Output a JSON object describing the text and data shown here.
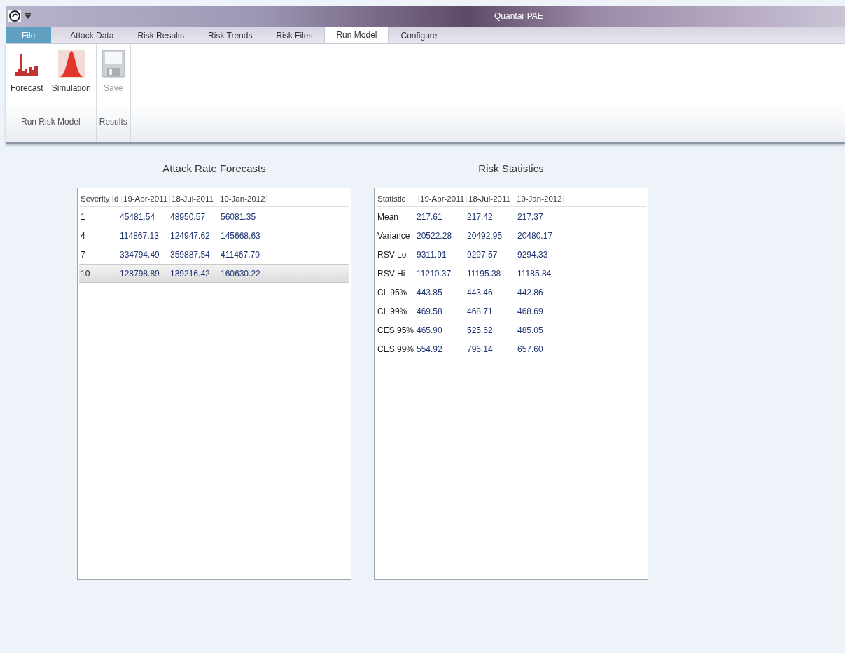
{
  "window": {
    "title": "Quantar PAE"
  },
  "tabs": [
    {
      "label": "File",
      "kind": "file",
      "selected": false
    },
    {
      "label": "Attack Data",
      "kind": "tab",
      "selected": false
    },
    {
      "label": "Risk Results",
      "kind": "tab",
      "selected": false
    },
    {
      "label": "Risk Trends",
      "kind": "tab",
      "selected": false
    },
    {
      "label": "Risk Files",
      "kind": "tab",
      "selected": false
    },
    {
      "label": "Run Model",
      "kind": "tab",
      "selected": true
    },
    {
      "label": "Configure",
      "kind": "tab",
      "selected": false
    }
  ],
  "ribbon_groups": [
    {
      "label": "Run Risk Model",
      "buttons": [
        {
          "label": "Forecast",
          "kind": "forecast",
          "disabled": false
        },
        {
          "label": "Simulation",
          "kind": "simulation",
          "disabled": false
        }
      ]
    },
    {
      "label": "Results",
      "buttons": [
        {
          "label": "Save",
          "kind": "save",
          "disabled": true
        }
      ]
    }
  ],
  "panels": [
    {
      "title": "Attack Rate Forecasts",
      "columns": [
        "Severity Id",
        "19-Apr-2011",
        "18-Jul-2011",
        "19-Jan-2012"
      ],
      "rows": [
        {
          "cells": [
            "1",
            "45481.54",
            "48950.57",
            "56081.35"
          ],
          "selected": false
        },
        {
          "cells": [
            "4",
            "114867.13",
            "124947.62",
            "145668.63"
          ],
          "selected": false
        },
        {
          "cells": [
            "7",
            "334794.49",
            "359887.54",
            "411467.70"
          ],
          "selected": false
        },
        {
          "cells": [
            "10",
            "128798.89",
            "139216.42",
            "160630.22"
          ],
          "selected": true
        }
      ]
    },
    {
      "title": "Risk Statistics",
      "columns": [
        "Statistic",
        "19-Apr-2011",
        "18-Jul-2011",
        "19-Jan-2012"
      ],
      "rows": [
        {
          "cells": [
            "Mean",
            "217.61",
            "217.42",
            "217.37"
          ],
          "selected": false
        },
        {
          "cells": [
            "Variance",
            "20522.28",
            "20492.95",
            "20480.17"
          ],
          "selected": false
        },
        {
          "cells": [
            "RSV-Lo",
            "9311.91",
            "9297.57",
            "9294.33"
          ],
          "selected": false
        },
        {
          "cells": [
            "RSV-Hi",
            "11210.37",
            "11195.38",
            "11185.84"
          ],
          "selected": false
        },
        {
          "cells": [
            "CL 95%",
            "443.85",
            "443.46",
            "442.86"
          ],
          "selected": false
        },
        {
          "cells": [
            "CL 99%",
            "469.58",
            "468.71",
            "468.69"
          ],
          "selected": false
        },
        {
          "cells": [
            "CES 95%",
            "465.90",
            "525.62",
            "485.05"
          ],
          "selected": false
        },
        {
          "cells": [
            "CES 99%",
            "554.92",
            "796.14",
            "657.60"
          ],
          "selected": false
        }
      ]
    }
  ]
}
